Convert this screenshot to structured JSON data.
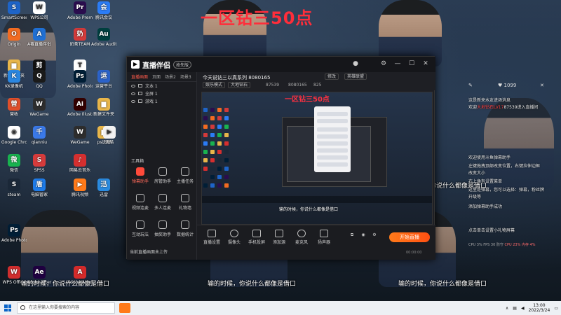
{
  "stream": {
    "title_overlay": "一区钻三50点",
    "caption": "输的时候，你说什么都像是借口"
  },
  "desktop_icons": [
    {
      "label": "SmartScreen",
      "color": "#1e64c8",
      "glyph": "S"
    },
    {
      "label": "WPS公司",
      "color": "#ffffff",
      "glyph": "W"
    },
    {
      "label": "Adobe Premiere",
      "color": "#2a0d4e",
      "glyph": "Pr"
    },
    {
      "label": "腾讯会议",
      "color": "#2b7cf6",
      "glyph": "会"
    },
    {
      "label": "Origin",
      "color": "#f26b21",
      "glyph": "O"
    },
    {
      "label": "A毒直播伴侣",
      "color": "#1f6fd3",
      "glyph": "A"
    },
    {
      "label": "奶茶TEAM",
      "color": "#d23a3a",
      "glyph": "奶"
    },
    {
      "label": "Adobe Audition",
      "color": "#003f3f",
      "glyph": "Au"
    },
    {
      "label": "新建文件夹",
      "color": "#e8b64a",
      "glyph": "▆"
    },
    {
      "label": "剪映",
      "color": "#111111",
      "glyph": "剪"
    },
    {
      "label": "TESTS",
      "color": "#ffffff",
      "glyph": "T"
    },
    {
      "label": "KK录像机",
      "color": "#2a86e0",
      "glyph": "K"
    },
    {
      "label": "QQ",
      "color": "#1a1a1a",
      "glyph": "Q"
    },
    {
      "label": "Adobe Photoshop",
      "color": "#001e36",
      "glyph": "Ps"
    },
    {
      "label": "运营平台",
      "color": "#2b62c9",
      "glyph": "运"
    },
    {
      "label": "营收",
      "color": "#e04f2a",
      "glyph": "营"
    },
    {
      "label": "WeGame",
      "color": "#2d2d2d",
      "glyph": "W"
    },
    {
      "label": "Adobe Illustrator",
      "color": "#330000",
      "glyph": "Ai"
    },
    {
      "label": "新建文件夹",
      "color": "#e8b64a",
      "glyph": "▆"
    },
    {
      "label": "Google Chrome",
      "color": "#ffffff",
      "glyph": "◉"
    },
    {
      "label": "qianniu",
      "color": "#3a79e8",
      "glyph": "千"
    },
    {
      "label": "WeGame",
      "color": "#2d2d2d",
      "glyph": "W"
    },
    {
      "label": "ps选图",
      "color": "#e8b64a",
      "glyph": "▆"
    },
    {
      "label": "优酷",
      "color": "#f2f2f2",
      "glyph": "▶"
    },
    {
      "label": "微信",
      "color": "#19b34f",
      "glyph": "微"
    },
    {
      "label": "SPSS",
      "color": "#d63b3b",
      "glyph": "S"
    },
    {
      "label": "网易云音乐",
      "color": "#d52f2f",
      "glyph": "♪"
    },
    {
      "label": "steam",
      "color": "#1b2838",
      "glyph": "S"
    },
    {
      "label": "电脑管家",
      "color": "#1e7be8",
      "glyph": "盾"
    },
    {
      "label": "腾讯视频",
      "color": "#ff7a1a",
      "glyph": "▶"
    },
    {
      "label": "迅雷",
      "color": "#2a8be0",
      "glyph": "迅"
    },
    {
      "label": "Adobe Photoshop",
      "color": "#001e36",
      "glyph": "Ps"
    },
    {
      "label": "WPS Office",
      "color": "#cf2e2e",
      "glyph": "W"
    },
    {
      "label": "Adobe After Effects",
      "color": "#1f0040",
      "glyph": "Ae"
    },
    {
      "label": "Adobe Acrobat",
      "color": "#d42a2a",
      "glyph": "A"
    }
  ],
  "app": {
    "name": "直播伴侣",
    "beta_badge": "抢先版",
    "tabs": [
      "直播画面",
      "页面",
      "场景2",
      "场景3"
    ],
    "scenes": [
      "文本 1",
      "全屏 1",
      "游戏 1"
    ],
    "room_title": "今天说钻三以真系列 8080165",
    "chip_edit": "修改",
    "chip_game": "英雄联盟",
    "chip_mode": "娱乐模式",
    "chip_rank": "大地钻石",
    "stat_fans": "87539",
    "stat_id": "8080165",
    "stat_online": "825",
    "tools_title": "工具箱",
    "tools": [
      {
        "label": "弹幕助手",
        "red": true
      },
      {
        "label": "房管助手",
        "red": false
      },
      {
        "label": "主播任务",
        "red": false
      },
      {
        "label": "视频连麦",
        "red": false
      },
      {
        "label": "多人连麦",
        "red": false
      },
      {
        "label": "礼物墙",
        "red": false
      },
      {
        "label": "互动玩法",
        "red": false
      },
      {
        "label": "抽奖助手",
        "red": false
      },
      {
        "label": "数据统计",
        "red": false
      }
    ],
    "warning": "当前直播画面未上传",
    "footer_buttons": [
      "直播设置",
      "摄像头",
      "手机投屏",
      "添加源",
      "麦克风",
      "扬声器"
    ],
    "start_live": "开始直播",
    "timer": "00:00:00"
  },
  "chat": {
    "stats": "♥ 1099",
    "messages": [
      {
        "text": "这是新来水友进场消息",
        "hl": ""
      },
      {
        "text": "欢迎",
        "hl": "大地钻石LV17",
        "tail": "87539进入直播间"
      },
      {
        "text": "欢迎使用斗鱼弹幕助手",
        "hl": ""
      },
      {
        "text": "左键拖拽顶部改变位置，右键拉伸边框",
        "hl": ""
      },
      {
        "text": "改变大小",
        "hl": ""
      },
      {
        "text": "右上角有设置菜单",
        "hl": ""
      },
      {
        "text": "这里是弹幕，您可以选择：弹幕，粉丝牌",
        "hl": ""
      },
      {
        "text": "升级等",
        "hl": ""
      },
      {
        "text": "添加弹幕助手成功",
        "hl": ""
      },
      {
        "text": "点击单击设置小礼物屏幕",
        "hl": ""
      }
    ],
    "bottom_stats": "CPU 3% FPS 30 防守",
    "bottom_red": "CPU 23% 内存 4%"
  },
  "taskbar": {
    "search_placeholder": "在这里输入你要搜索的内容",
    "time": "13:00",
    "date": "2022/3/24"
  }
}
